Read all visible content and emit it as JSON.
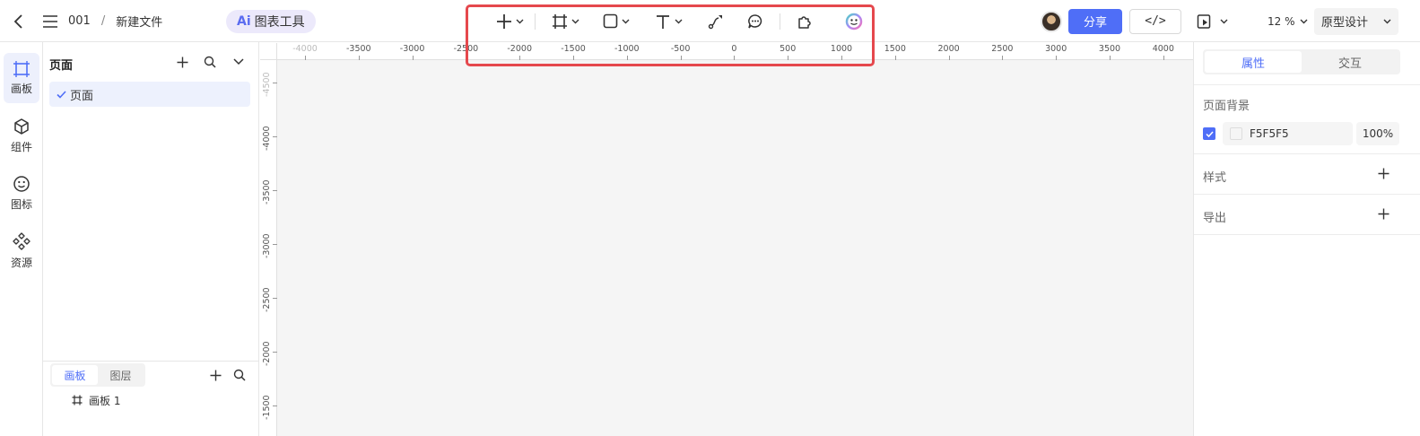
{
  "topbar": {
    "breadcrumb": {
      "project": "001",
      "separator": "/",
      "file": "新建文件"
    },
    "ai_chip": {
      "mark": "Ai",
      "label": "图表工具"
    },
    "tools": [
      "plus-icon",
      "frame-icon",
      "rectangle-icon",
      "text-icon",
      "pen-icon",
      "comment-icon",
      "plugin-icon",
      "ai-face-icon"
    ],
    "share_label": "分享",
    "code_label": "</>",
    "zoom": "12 %",
    "mode": "原型设计",
    "accent": "#4f6ef7",
    "highlight_color": "#e5484d"
  },
  "rail": [
    {
      "label": "画板",
      "icon": "artboard-icon",
      "active": true
    },
    {
      "label": "组件",
      "icon": "cube-icon"
    },
    {
      "label": "图标",
      "icon": "smiley-icon"
    },
    {
      "label": "资源",
      "icon": "diamonds-icon"
    }
  ],
  "pages": {
    "title": "页面",
    "items": [
      {
        "label": "页面",
        "selected": true
      }
    ],
    "bottom_tabs": [
      "画板",
      "图层"
    ],
    "bottom_active": "画板",
    "artboards": [
      {
        "label": "画板 1"
      }
    ]
  },
  "canvas": {
    "background": "#F5F5F5",
    "ruler_top": [
      "-4000",
      "-3500",
      "-3000",
      "-2500",
      "-2000",
      "-1500",
      "-1000",
      "-500",
      "0",
      "500",
      "1000",
      "1500",
      "2000",
      "2500",
      "3000",
      "3500",
      "4000"
    ],
    "ruler_left": [
      "-4500",
      "-4000",
      "-3500",
      "-3000",
      "-2500",
      "-2000",
      "-1500"
    ]
  },
  "props": {
    "tabs": [
      "属性",
      "交互"
    ],
    "active_tab": "属性",
    "page_bg_label": "页面背景",
    "bg_value": "F5F5F5",
    "bg_opacity": "100%",
    "style_label": "样式",
    "export_label": "导出"
  }
}
